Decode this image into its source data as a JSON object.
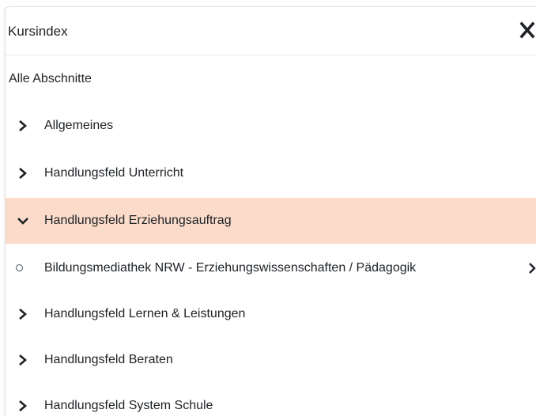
{
  "drawer": {
    "title": "Kursindex",
    "close_icon": "close-icon"
  },
  "all_sections_label": "Alle Abschnitte",
  "sections": [
    {
      "label": "Allgemeines",
      "expanded": false
    },
    {
      "label": "Handlungsfeld Unterricht",
      "expanded": false
    },
    {
      "label": "Handlungsfeld Erziehungsauftrag",
      "expanded": true,
      "highlighted": true
    },
    {
      "label": "Handlungsfeld Lernen & Leistungen",
      "expanded": false
    },
    {
      "label": "Handlungsfeld Beraten",
      "expanded": false
    },
    {
      "label": "Handlungsfeld System Schule",
      "expanded": false
    }
  ],
  "activity": {
    "label": "Bildungsmediathek NRW - Erziehungswissenschaften / Pädagogik"
  },
  "colors": {
    "highlight": "#fbdccb",
    "text": "#1d2125"
  }
}
